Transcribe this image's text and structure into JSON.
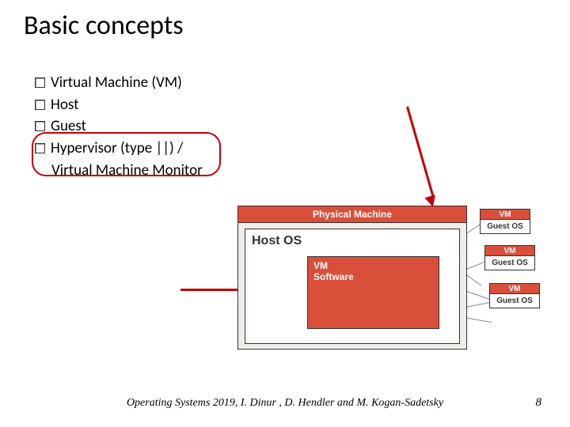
{
  "title": "Basic concepts",
  "bullets": {
    "b1": "Virtual Machine (VM)",
    "b2": "Host",
    "b3": "Guest",
    "b4": "Hypervisor (type ||) /",
    "b4b": "Virtual Machine Monitor"
  },
  "diagram": {
    "physical": "Physical Machine",
    "hostos": "Host OS",
    "vmsoft_l1": "VM",
    "vmsoft_l2": "Software",
    "vm": "VM",
    "guest": "Guest OS"
  },
  "footer": "Operating Systems 2019, I. Dinur , D. Hendler and M. Kogan-Sadetsky",
  "page": "8"
}
